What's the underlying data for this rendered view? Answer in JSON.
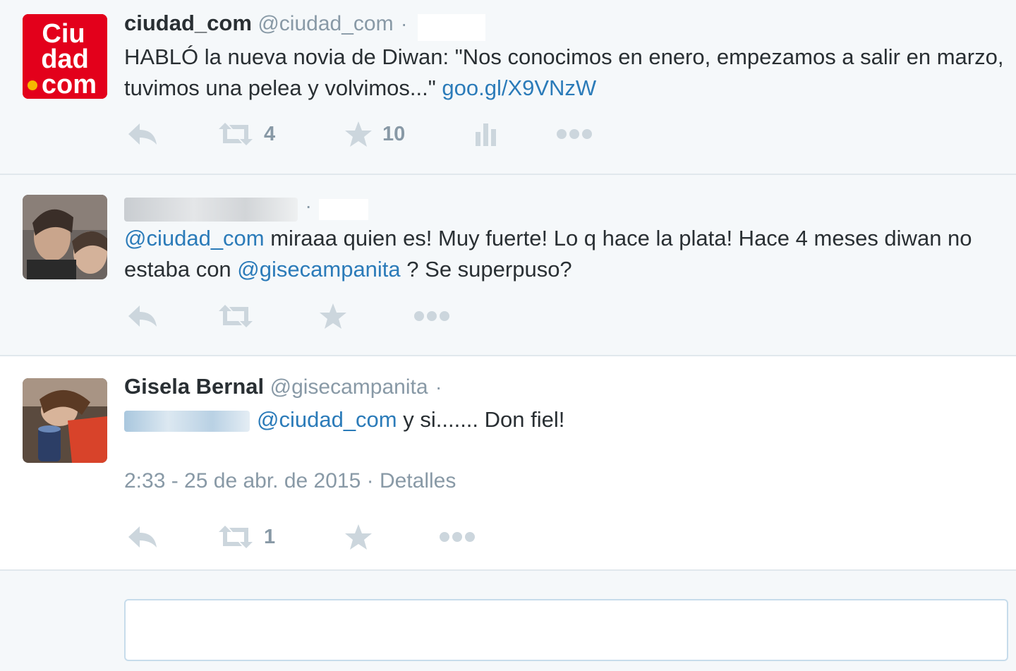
{
  "tweets": [
    {
      "fullname": "ciudad_com",
      "username": "@ciudad_com",
      "separator": "·",
      "avatar_text": [
        "Ciu",
        "dad",
        "com"
      ],
      "text_before": "HABLÓ la nueva novia de Diwan: \"Nos conocimos en enero, empezamos a salir en marzo, tuvimos una pelea y volvimos...\" ",
      "link": "goo.gl/X9VNzW",
      "retweets": "4",
      "favorites": "10"
    },
    {
      "separator": "·",
      "mention1": "@ciudad_com",
      "text_mid": " miraaa quien es! Muy fuerte! Lo q hace la plata! Hace 4 meses diwan no estaba con ",
      "mention2": "@gisecampanita",
      "text_end": " ? Se superpuso?"
    },
    {
      "fullname": "Gisela Bernal",
      "username": "@gisecampanita",
      "separator": "·",
      "mention2": "@ciudad_com",
      "text_end": " y si....... Don fiel!",
      "timestamp": "2:33 - 25 de abr. de 2015",
      "meta_sep": " · ",
      "details": "Detalles",
      "retweets": "1"
    }
  ],
  "colors": {
    "link": "#2b7bb9",
    "muted": "#8899a6",
    "icon": "#ccd6dd",
    "brand_red": "#e3001b",
    "brand_dot": "#f6b800"
  },
  "icons": [
    "reply-icon",
    "retweet-icon",
    "favorite-icon",
    "analytics-icon",
    "more-icon"
  ]
}
